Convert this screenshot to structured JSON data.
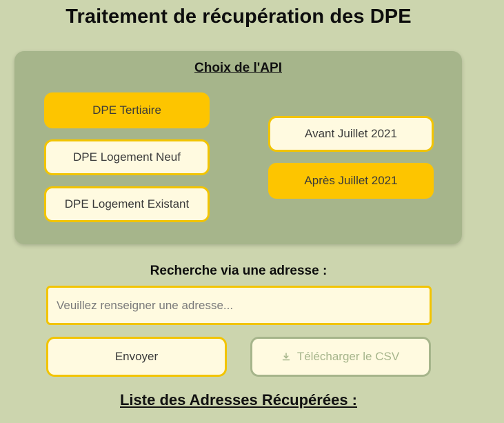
{
  "page": {
    "title": "Traitement de récupération des DPE"
  },
  "api_panel": {
    "title": "Choix de l'API",
    "type_buttons": [
      {
        "label": "DPE Tertiaire",
        "selected": true
      },
      {
        "label": "DPE Logement Neuf",
        "selected": false
      },
      {
        "label": "DPE Logement Existant",
        "selected": false
      }
    ],
    "period_buttons": [
      {
        "label": "Avant Juillet 2021",
        "selected": false
      },
      {
        "label": "Après Juillet 2021",
        "selected": true
      }
    ]
  },
  "search": {
    "label": "Recherche via une adresse :",
    "value": "",
    "placeholder": "Veuillez renseigner une adresse...",
    "submit_label": "Envoyer",
    "csv_label": "Télécharger le CSV"
  },
  "results": {
    "title": "Liste des Adresses Récupérées :"
  },
  "colors": {
    "background": "#ccd5ae",
    "panel": "#a6b58b",
    "accent": "#fdc500",
    "button_fill": "#fffae0"
  },
  "icons": {
    "csv_button": "download-icon"
  }
}
